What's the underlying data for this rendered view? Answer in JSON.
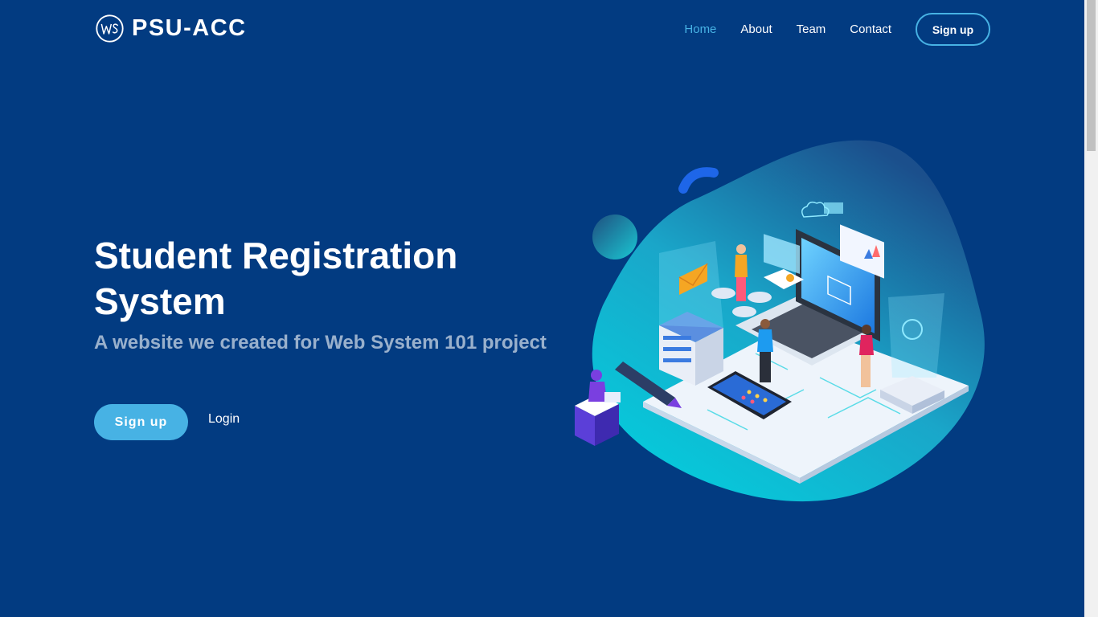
{
  "brand": {
    "name": "PSU-ACC",
    "logo_icon": "ws-circle-logo-icon"
  },
  "nav": {
    "items": [
      {
        "label": "Home",
        "active": true
      },
      {
        "label": "About",
        "active": false
      },
      {
        "label": "Team",
        "active": false
      },
      {
        "label": "Contact",
        "active": false
      }
    ],
    "signup_label": "Sign up"
  },
  "hero": {
    "title": "Student Registration System",
    "subtitle": "A website we created for Web System 101 project",
    "signup_label": "Sign up",
    "login_label": "Login",
    "illustration": "isometric-tech-illustration"
  },
  "colors": {
    "background": "#023b81",
    "accent": "#47b2e4",
    "text": "#ffffff"
  }
}
